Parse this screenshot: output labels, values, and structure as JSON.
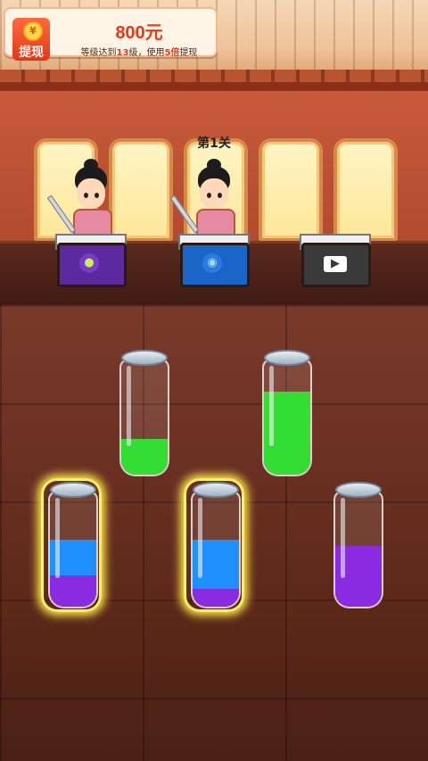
{
  "header": {
    "withdraw_label": "提现",
    "coin_symbol": "¥",
    "amount": "800元",
    "hint_part1": "等级达到",
    "hint_level": "13",
    "hint_part2": "级，使用",
    "hint_multiplier": "5倍",
    "hint_part3": "提现"
  },
  "level": {
    "label": "第1关"
  },
  "colors": {
    "green": "#33dd33",
    "blue": "#1e90ff",
    "purple": "#8a2be2"
  },
  "boxes": [
    {
      "name": "grape",
      "icon": "grape-icon",
      "color": "#5b2a9e"
    },
    {
      "name": "earth",
      "icon": "earth-icon",
      "color": "#1a66c8"
    },
    {
      "name": "video",
      "icon": "video-icon",
      "color": "#3a3a3a"
    }
  ],
  "bottles": [
    {
      "selected": false,
      "layers": [
        {
          "color": "green",
          "fraction": 0.32
        }
      ]
    },
    {
      "selected": false,
      "layers": [
        {
          "color": "green",
          "fraction": 0.75
        }
      ]
    },
    {
      "selected": true,
      "layers": [
        {
          "color": "purple",
          "fraction": 0.28
        },
        {
          "color": "blue",
          "fraction": 0.32
        }
      ]
    },
    {
      "selected": true,
      "layers": [
        {
          "color": "purple",
          "fraction": 0.16
        },
        {
          "color": "blue",
          "fraction": 0.44
        }
      ]
    },
    {
      "selected": false,
      "layers": [
        {
          "color": "purple",
          "fraction": 0.55
        }
      ]
    }
  ]
}
